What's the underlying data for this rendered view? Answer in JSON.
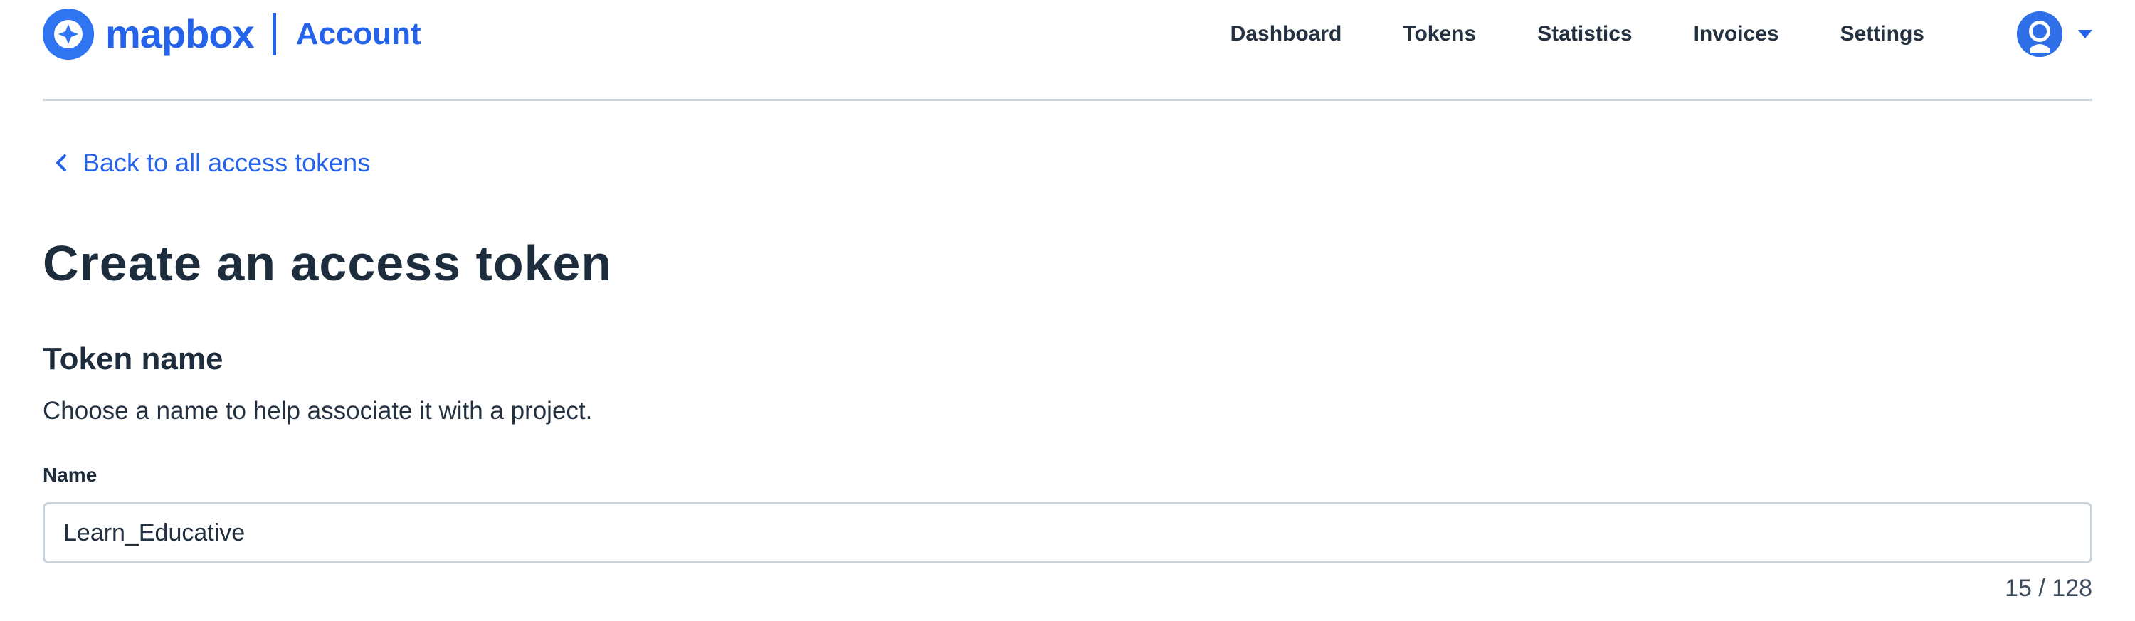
{
  "header": {
    "logo_text": "mapbox",
    "section": "Account",
    "nav": [
      "Dashboard",
      "Tokens",
      "Statistics",
      "Invoices",
      "Settings"
    ],
    "avatar_icon": "user-avatar-icon",
    "menu_icon": "caret-down-icon"
  },
  "back_link": {
    "label": "Back to all access tokens",
    "icon": "chevron-left-icon"
  },
  "page_title": "Create an access token",
  "token_name": {
    "heading": "Token name",
    "description": "Choose a name to help associate it with a project.",
    "field_label": "Name",
    "value": "Learn_Educative",
    "char_count": "15 / 128"
  },
  "colors": {
    "brand": "#2563eb",
    "text": "#1e2d3d",
    "border": "#c9d3de"
  }
}
